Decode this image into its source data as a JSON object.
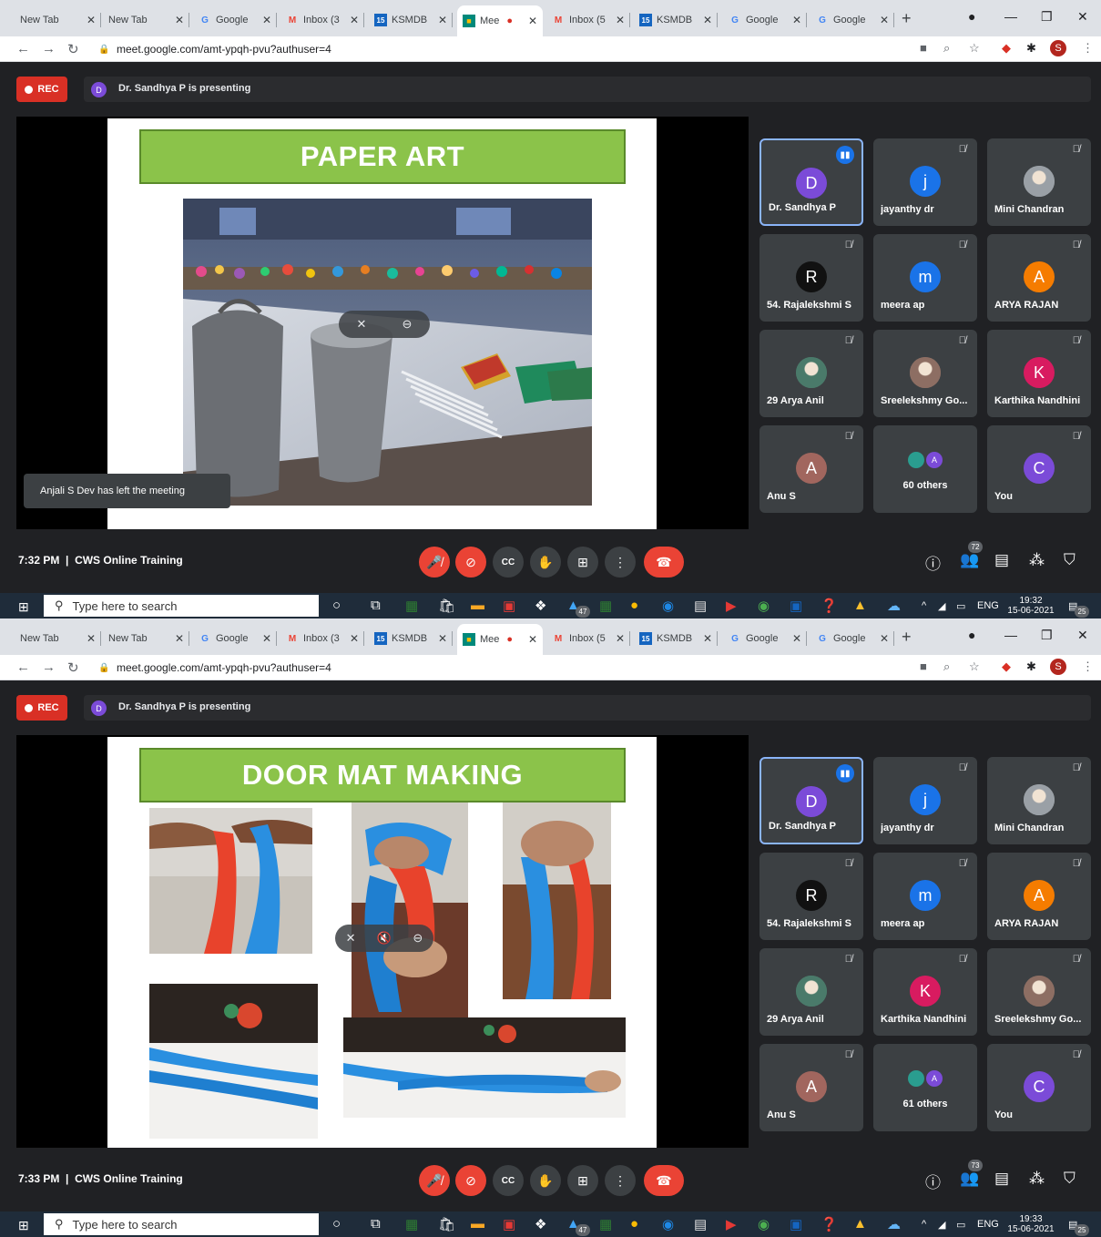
{
  "screens": [
    {
      "tabs": [
        "New Tab",
        "New Tab",
        "Google",
        "Inbox (3",
        "KSMDB",
        "Mee",
        "Inbox (5",
        "KSMDB",
        "Google",
        "Google"
      ],
      "url": "meet.google.com/amt-ypqh-pvu?authuser=4",
      "profile_initial": "S",
      "rec_label": "REC",
      "presenter_initial": "D",
      "presenting_text": "Dr. Sandhya P is presenting",
      "slide_title": "PAPER ART",
      "toast": "Anjali S Dev has left the meeting",
      "participants": [
        {
          "name": "Dr. Sandhya P",
          "initial": "D",
          "color": "#7b4bd8",
          "speaking": true
        },
        {
          "name": "jayanthy dr",
          "initial": "j",
          "color": "#1a73e8"
        },
        {
          "name": "Mini Chandran",
          "initial": "",
          "color": "#9aa0a6"
        },
        {
          "name": "54. Rajalekshmi S",
          "initial": "R",
          "color": "#111111"
        },
        {
          "name": "meera ap",
          "initial": "m",
          "color": "#1a73e8"
        },
        {
          "name": "ARYA RAJAN",
          "initial": "A",
          "color": "#f57c00"
        },
        {
          "name": "29 Arya Anil",
          "initial": "",
          "color": "#4a7a6a"
        },
        {
          "name": "Sreelekshmy Go...",
          "initial": "",
          "color": "#8d6e63"
        },
        {
          "name": "Karthika Nandhini",
          "initial": "K",
          "color": "#d81b60"
        },
        {
          "name": "Anu S",
          "initial": "A",
          "color": "#a1665e"
        },
        {
          "name": "60 others",
          "initial": "",
          "color": "#3c4043",
          "others": true
        },
        {
          "name": "You",
          "initial": "C",
          "color": "#7b4bd8"
        }
      ],
      "meeting_time": "7:32 PM",
      "meeting_name": "CWS Online Training",
      "people_count": "72",
      "taskbar_search": "Type here to search",
      "taskbar_badge": "47",
      "lang": "ENG",
      "clock_time": "19:32",
      "clock_date": "15-06-2021",
      "notif_count": "25"
    },
    {
      "tabs": [
        "New Tab",
        "New Tab",
        "Google",
        "Inbox (3",
        "KSMDB",
        "Mee",
        "Inbox (5",
        "KSMDB",
        "Google",
        "Google"
      ],
      "url": "meet.google.com/amt-ypqh-pvu?authuser=4",
      "profile_initial": "S",
      "rec_label": "REC",
      "presenter_initial": "D",
      "presenting_text": "Dr. Sandhya P is presenting",
      "slide_title": "DOOR MAT MAKING",
      "toast": "",
      "participants": [
        {
          "name": "Dr. Sandhya P",
          "initial": "D",
          "color": "#7b4bd8",
          "speaking": true
        },
        {
          "name": "jayanthy dr",
          "initial": "j",
          "color": "#1a73e8"
        },
        {
          "name": "Mini Chandran",
          "initial": "",
          "color": "#9aa0a6"
        },
        {
          "name": "54. Rajalekshmi S",
          "initial": "R",
          "color": "#111111"
        },
        {
          "name": "meera ap",
          "initial": "m",
          "color": "#1a73e8"
        },
        {
          "name": "ARYA RAJAN",
          "initial": "A",
          "color": "#f57c00"
        },
        {
          "name": "29 Arya Anil",
          "initial": "",
          "color": "#4a7a6a"
        },
        {
          "name": "Karthika Nandhini",
          "initial": "K",
          "color": "#d81b60"
        },
        {
          "name": "Sreelekshmy Go...",
          "initial": "",
          "color": "#8d6e63"
        },
        {
          "name": "Anu S",
          "initial": "A",
          "color": "#a1665e"
        },
        {
          "name": "61 others",
          "initial": "",
          "color": "#3c4043",
          "others": true
        },
        {
          "name": "You",
          "initial": "C",
          "color": "#7b4bd8"
        }
      ],
      "meeting_time": "7:33 PM",
      "meeting_name": "CWS Online Training",
      "people_count": "73",
      "taskbar_search": "Type here to search",
      "taskbar_badge": "47",
      "lang": "ENG",
      "clock_time": "19:33",
      "clock_date": "15-06-2021",
      "notif_count": "25"
    }
  ]
}
